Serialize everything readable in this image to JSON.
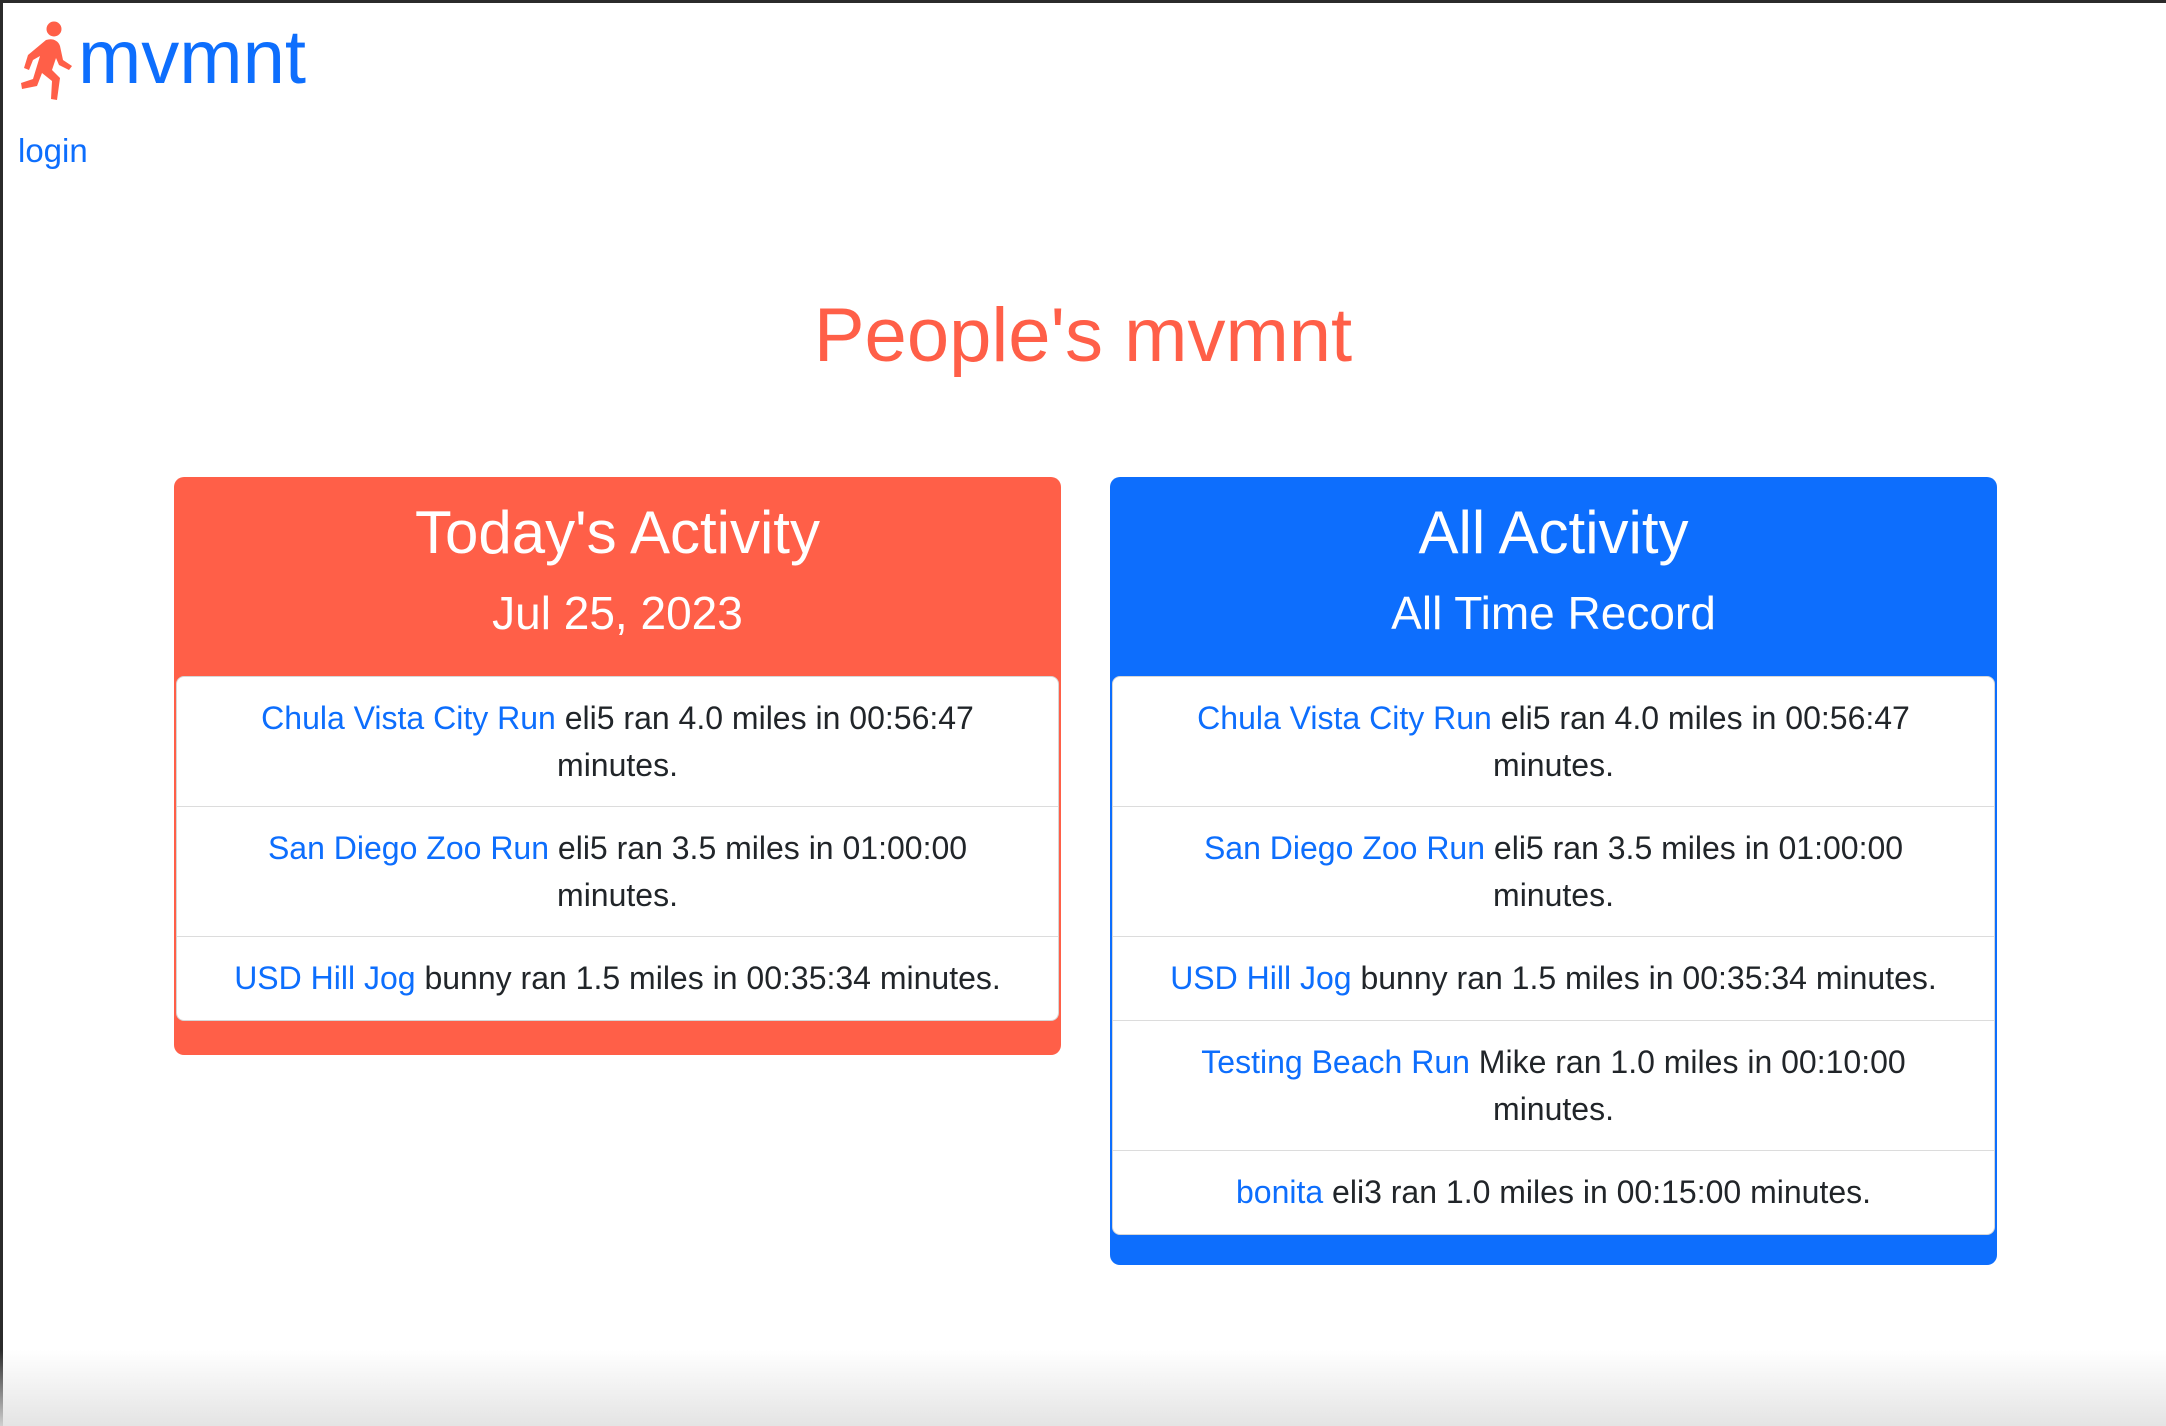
{
  "colors": {
    "brand_blue": "#0d6efd",
    "accent_coral": "#ff5f48",
    "text_dark": "#212529"
  },
  "nav": {
    "brand_name": "mvmnt",
    "brand_icon": "running-person-icon",
    "login_label": "login"
  },
  "page": {
    "title": "People's mvmnt"
  },
  "today_card": {
    "title": "Today's Activity",
    "subtitle": "Jul 25, 2023",
    "items": [
      {
        "link": "Chula Vista City Run",
        "text": " eli5 ran 4.0 miles in 00:56:47 minutes."
      },
      {
        "link": "San Diego Zoo Run",
        "text": " eli5 ran 3.5 miles in 01:00:00 minutes."
      },
      {
        "link": "USD Hill Jog",
        "text": " bunny ran 1.5 miles in 00:35:34 minutes."
      }
    ]
  },
  "all_card": {
    "title": "All Activity",
    "subtitle": "All Time Record",
    "items": [
      {
        "link": "Chula Vista City Run",
        "text": " eli5 ran 4.0 miles in 00:56:47 minutes."
      },
      {
        "link": "San Diego Zoo Run",
        "text": " eli5 ran 3.5 miles in 01:00:00 minutes."
      },
      {
        "link": "USD Hill Jog",
        "text": " bunny ran 1.5 miles in 00:35:34 minutes."
      },
      {
        "link": "Testing Beach Run",
        "text": " Mike ran 1.0 miles in 00:10:00 minutes."
      },
      {
        "link": "bonita",
        "text": " eli3 ran 1.0 miles in 00:15:00 minutes."
      }
    ]
  }
}
